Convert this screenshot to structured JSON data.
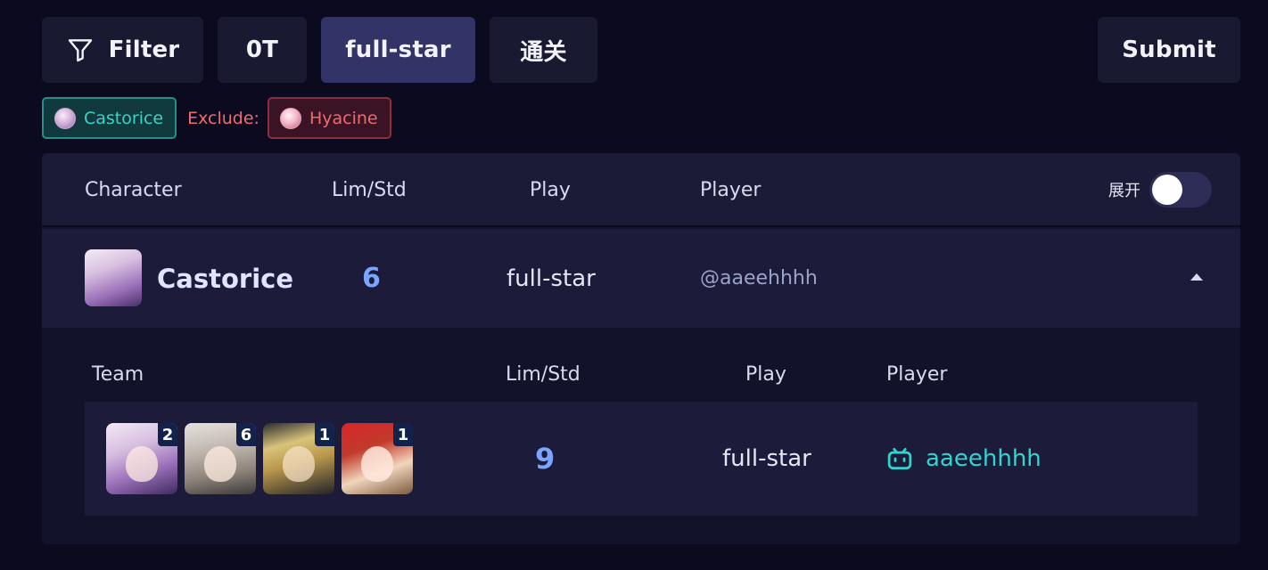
{
  "toolbar": {
    "filter_label": "Filter",
    "filter_icon": "filter-icon",
    "btn_0t": "0T",
    "btn_fullstar": "full-star",
    "btn_pass": "通关",
    "submit_label": "Submit",
    "active_button": "full-star"
  },
  "tags": {
    "include": {
      "label": "Castorice",
      "color": "#3ad3c4"
    },
    "exclude_prefix": "Exclude:",
    "exclude": {
      "label": "Hyacine",
      "color": "#f06a72"
    }
  },
  "table": {
    "headers": {
      "character": "Character",
      "lim_std": "Lim/Std",
      "play": "Play",
      "player": "Player"
    },
    "expand_label": "展开",
    "expand_toggle_on": false,
    "rows": [
      {
        "character": "Castorice",
        "lim_std": "6",
        "play": "full-star",
        "player": "@aaeehhhh",
        "expanded": true,
        "detail": {
          "headers": {
            "team": "Team",
            "lim_std": "Lim/Std",
            "play": "Play",
            "player": "Player"
          },
          "teams": [
            {
              "members": [
                {
                  "badge": "2"
                },
                {
                  "badge": "6"
                },
                {
                  "badge": "1"
                },
                {
                  "badge": "1"
                }
              ],
              "lim_std": "9",
              "play": "full-star",
              "player": "aaeehhhh",
              "player_icon": "bilibili-icon"
            }
          ]
        }
      }
    ]
  },
  "colors": {
    "background": "#0b0a1e",
    "accent_blue": "#7aa6ff",
    "accent_teal": "#2fd6d0",
    "exclude_red": "#ef6b74"
  }
}
